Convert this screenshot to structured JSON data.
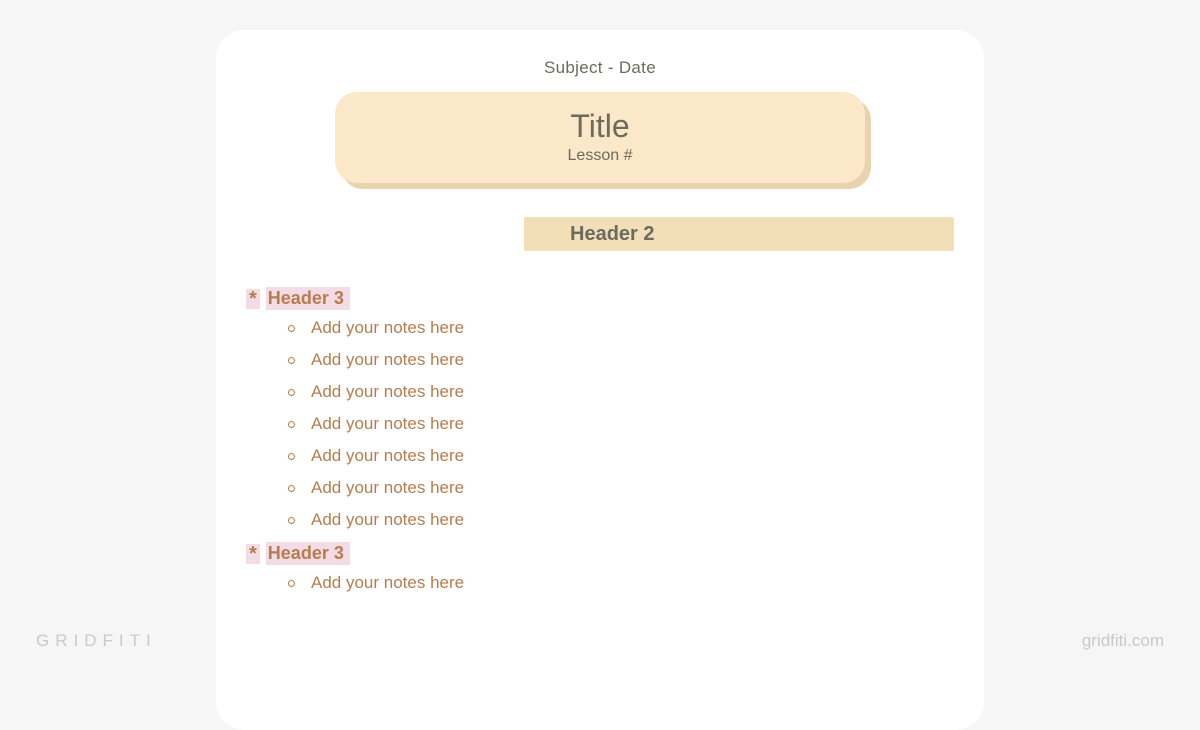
{
  "meta": {
    "subject_date": "Subject - Date"
  },
  "title_card": {
    "title": "Title",
    "lesson": "Lesson #"
  },
  "header2": "Header 2",
  "sections": [
    {
      "header3": "Header 3",
      "notes": [
        "Add your notes here",
        "Add your notes here",
        "Add your notes here",
        "Add your notes here",
        "Add your notes here",
        "Add your notes here",
        "Add your notes here"
      ]
    },
    {
      "header3": "Header 3",
      "notes": [
        "Add your notes here"
      ]
    }
  ],
  "watermark": {
    "left": "GRIDFITI",
    "right": "gridfiti.com"
  },
  "colors": {
    "page_bg": "#f6f6f6",
    "card_bg": "#ffffff",
    "title_box": "#fbe8c9",
    "title_box_shadow": "#e8d3ae",
    "header2_bar": "#f2dfb8",
    "accent_text": "#b77d4e",
    "muted_text": "#6c6b5e",
    "highlight_pink": "#f4dce6"
  }
}
